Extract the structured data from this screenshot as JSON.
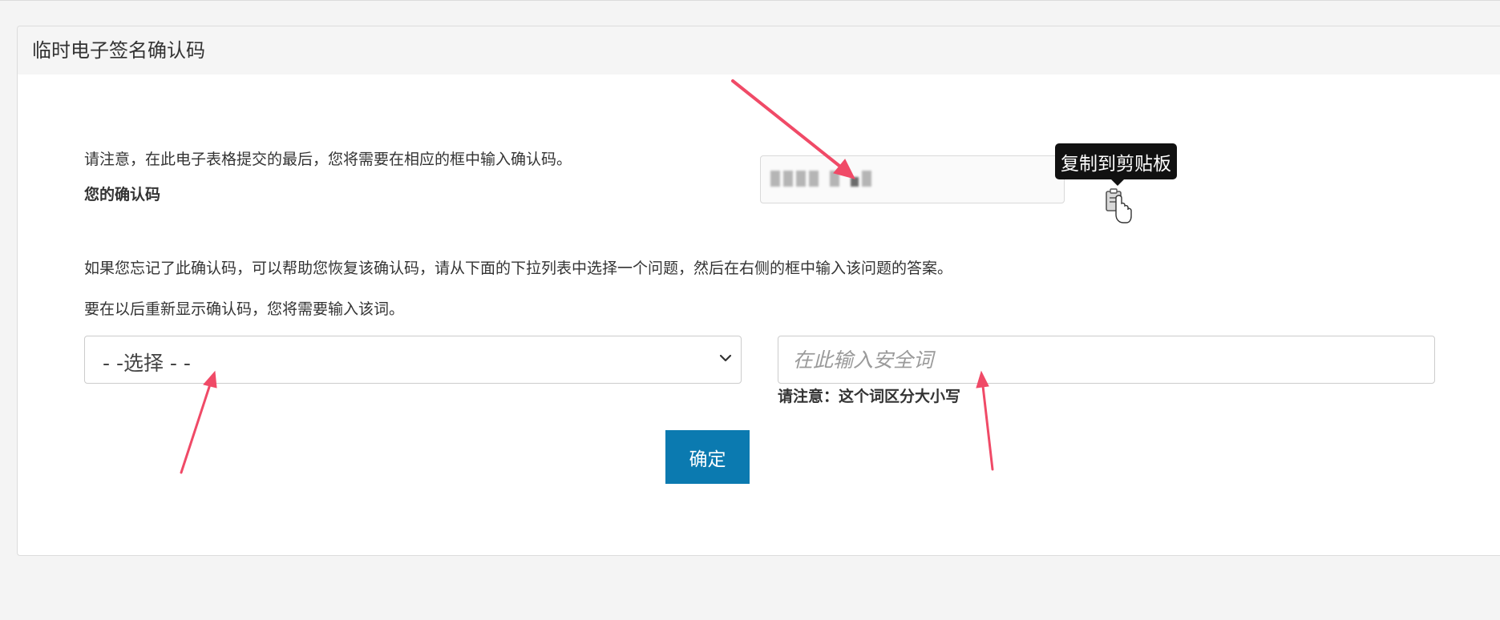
{
  "panel": {
    "title": "临时电子签名确认码"
  },
  "notice": {
    "intro": "请注意，在此电子表格提交的最后，您将需要在相应的框中输入确认码。",
    "code_label": "您的确认码",
    "recovery_text": "如果您忘记了此确认码，可以帮助您恢复该确认码，请从下面的下拉列表中选择一个问题，然后在右侧的框中输入该问题的答案。",
    "redisplay_text": "要在以后重新显示确认码，您将需要输入该词。"
  },
  "clipboard": {
    "tooltip": "复制到剪贴板",
    "icon": "clipboard-icon"
  },
  "question_select": {
    "selected": "- -选择 - -"
  },
  "security_word": {
    "placeholder": "在此输入安全词",
    "case_note": "请注意：这个词区分大小写"
  },
  "actions": {
    "confirm_label": "确定"
  },
  "colors": {
    "primary_button": "#0b7ab0",
    "annotation_arrow": "#f04a67",
    "tooltip_bg": "#111111"
  }
}
